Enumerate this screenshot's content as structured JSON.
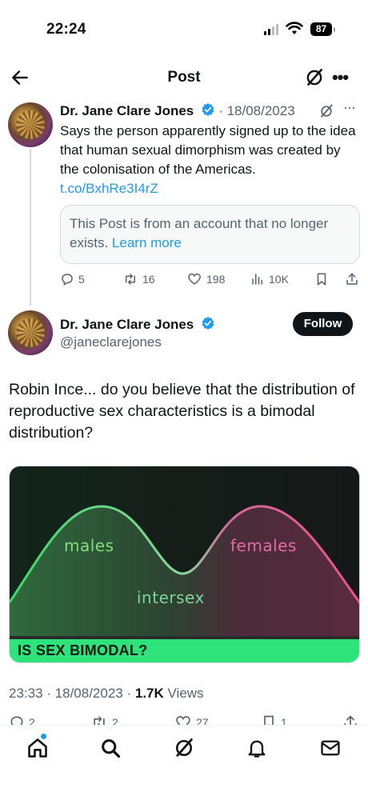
{
  "status_bar": {
    "time": "22:24",
    "battery": "87"
  },
  "nav": {
    "title": "Post"
  },
  "quoted_post": {
    "author": "Dr. Jane Clare Jones",
    "date": "18/08/2023",
    "text": "Says the person apparently signed up to the idea that human sexual dimorphism was created by the colonisation of the Americas.",
    "link": "t.co/BxhRe3I4rZ",
    "notice_text": "This Post is from an account that no longer exists.",
    "notice_link": "Learn more",
    "stats": {
      "replies": "5",
      "reposts": "16",
      "likes": "198",
      "views": "10K"
    }
  },
  "main_post": {
    "author": "Dr. Jane Clare Jones",
    "handle": "@janeclarejones",
    "follow_label": "Follow",
    "text": "Robin Ince... do you believe that the distribution of reproductive sex characteristics is a bimodal distribution?",
    "media": {
      "label_males": "males",
      "label_females": "females",
      "label_intersex": "intersex",
      "banner": "IS SEX BIMODAL?",
      "colors": {
        "males": "#7fe07a",
        "females": "#e46aa3",
        "banner": "#2de37a"
      }
    },
    "time": "23:33",
    "date": "18/08/2023",
    "views_count": "1.7K",
    "views_label": "Views",
    "stats": {
      "replies": "2",
      "reposts": "2",
      "likes": "27",
      "bookmarks": "1"
    }
  },
  "tab_bar": {
    "items": [
      "home-icon",
      "search-icon",
      "grok-icon",
      "notifications-icon",
      "messages-icon"
    ],
    "accent": "#1d9bf0"
  }
}
